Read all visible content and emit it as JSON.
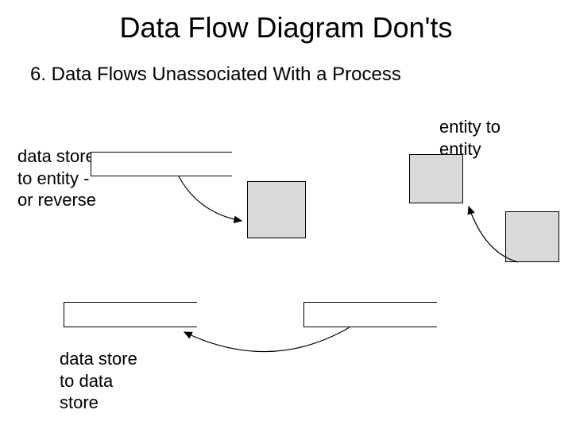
{
  "title": "Data Flow Diagram Don'ts",
  "subtitle": "6. Data Flows Unassociated With a Process",
  "labels": {
    "datastore_to_entity": "data store\nto entity -\nor reverse",
    "entity_to_entity": "entity to\nentity",
    "datastore_to_datastore": "data store\nto data\nstore"
  }
}
